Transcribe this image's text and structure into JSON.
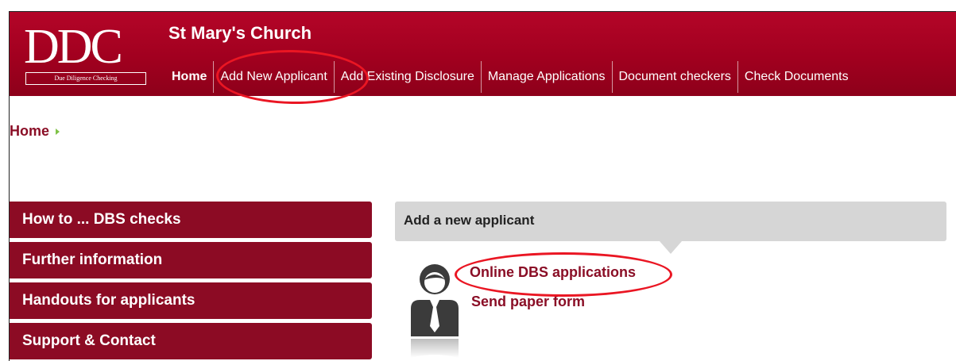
{
  "header": {
    "logo_text": "DDC",
    "logo_tagline": "Due Diligence Checking",
    "org_name": "St Mary's Church",
    "nav": [
      {
        "label": "Home"
      },
      {
        "label": "Add New Applicant"
      },
      {
        "label": "Add Existing Disclosure"
      },
      {
        "label": "Manage Applications"
      },
      {
        "label": "Document checkers"
      },
      {
        "label": "Check Documents"
      }
    ]
  },
  "breadcrumb": {
    "home": "Home"
  },
  "sidebar": {
    "items": [
      {
        "label": "How to ... DBS checks"
      },
      {
        "label": "Further information"
      },
      {
        "label": "Handouts for applicants"
      },
      {
        "label": "Support & Contact"
      }
    ]
  },
  "panel": {
    "title": "Add a new applicant",
    "icon": "person-icon",
    "links": [
      {
        "label": "Online DBS applications"
      },
      {
        "label": "Send paper form"
      }
    ]
  },
  "colors": {
    "brand": "#a1001f",
    "sidebar": "#8c0b24",
    "link": "#8a0e26",
    "annotation": "#ea1623",
    "panel_header": "#d6d6d6"
  }
}
